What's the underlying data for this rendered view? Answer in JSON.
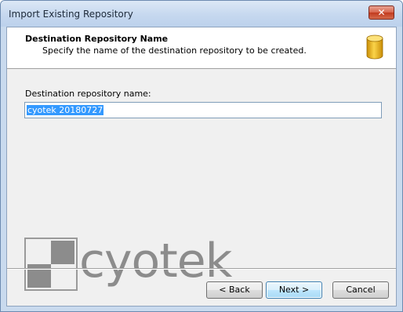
{
  "window": {
    "title": "Import Existing Repository",
    "close_glyph": "✕"
  },
  "header": {
    "title": "Destination Repository Name",
    "subtitle": "Specify the name of the destination repository to be created.",
    "icon": "database-icon"
  },
  "form": {
    "label": "Destination repository name:",
    "value": "cyotek 20180727"
  },
  "branding": {
    "logo_text": "cyotek"
  },
  "buttons": {
    "back": "< Back",
    "next": "Next >",
    "cancel": "Cancel"
  },
  "colors": {
    "accent": "#3399ff",
    "db_gold": "#e8b312"
  }
}
